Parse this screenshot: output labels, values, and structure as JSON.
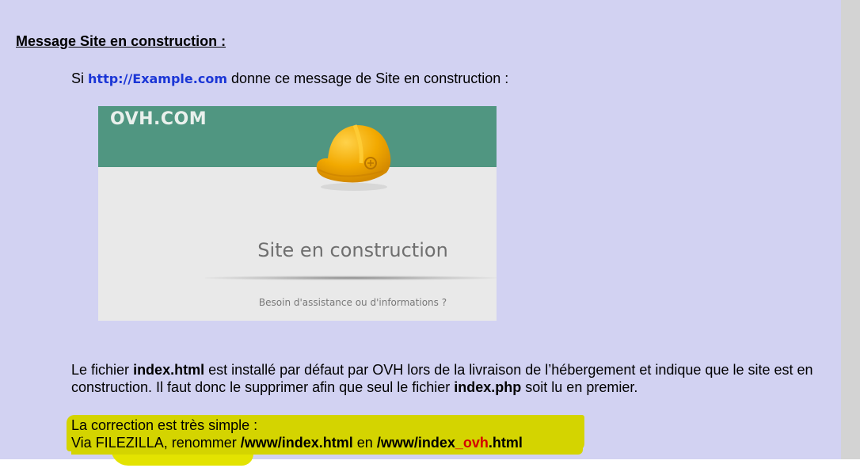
{
  "heading": "Message Site en construction :",
  "intro": {
    "prefix": "Si",
    "url": "http://Example.com",
    "suffix": "donne ce message de Site en construction :"
  },
  "screenshot": {
    "brand": "OVH.COM",
    "title": "Site en construction",
    "subtitle": "Besoin d'assistance ou d'informations ?",
    "icon": "construction-helmet-icon",
    "band_color": "#509681",
    "helmet_color": "#f2a900"
  },
  "explanation": {
    "t1": "Le fichier",
    "b1": "index.html",
    "t2": "  est installé par défaut par OVH lors de la livraison de l’hébergement et indique que le site est en construction. Il faut donc le supprimer afin que seul le fichier",
    "b2": "index.php",
    "t3": "soit lu en premier."
  },
  "correction": {
    "line1": "La correction est très simple :",
    "prefix": "Via FILEZILLA, renommer",
    "old_path": "/www/index.html",
    "middle": "  en",
    "new_path_start": "/www/index",
    "new_path_red": "_ovh",
    "new_path_end": ".html"
  },
  "colors": {
    "page_background": "#d2d2f2",
    "link": "#1b36d6",
    "highlight": "#d4d400",
    "accent_red": "#d40000"
  }
}
